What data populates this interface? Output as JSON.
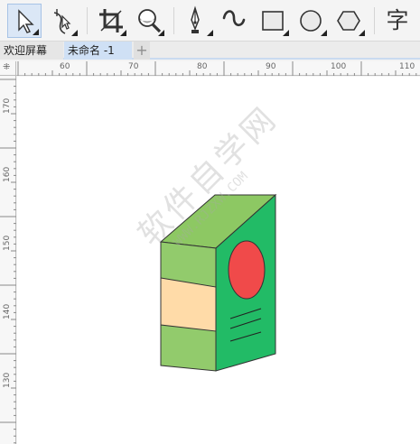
{
  "toolbar": {
    "tools": [
      {
        "name": "pick-tool",
        "icon": "arrow-pointer-icon"
      },
      {
        "name": "shape-tool",
        "icon": "shape-node-icon"
      },
      {
        "name": "crop-tool",
        "icon": "crop-icon"
      },
      {
        "name": "zoom-tool",
        "icon": "magnifier-icon"
      },
      {
        "name": "pen-tool",
        "icon": "pen-nib-icon"
      },
      {
        "name": "curve-tool",
        "icon": "curve-icon"
      },
      {
        "name": "rectangle-tool",
        "icon": "rectangle-icon"
      },
      {
        "name": "ellipse-tool",
        "icon": "ellipse-icon"
      },
      {
        "name": "polygon-tool",
        "icon": "hexagon-icon"
      },
      {
        "name": "text-tool",
        "icon": "text-glyph-icon"
      }
    ],
    "text_tool_glyph": "字"
  },
  "tabs": {
    "welcome": "欢迎屏幕",
    "document": "未命名 -1",
    "add": "+"
  },
  "ruler": {
    "horizontal": [
      "60",
      "70",
      "80",
      "90",
      "100",
      "110"
    ],
    "vertical": [
      "170",
      "160",
      "150",
      "140",
      "130"
    ]
  },
  "watermark": {
    "text": "软件自学网",
    "url": "WWW.RJZXW.COM"
  },
  "colors": {
    "box_top": "#8dc863",
    "box_front_green": "#92cb6c",
    "box_front_band": "#ffdba8",
    "box_side": "#22bb66",
    "circle": "#f04a4a",
    "active_tool_bg": "#dbe7f6"
  }
}
